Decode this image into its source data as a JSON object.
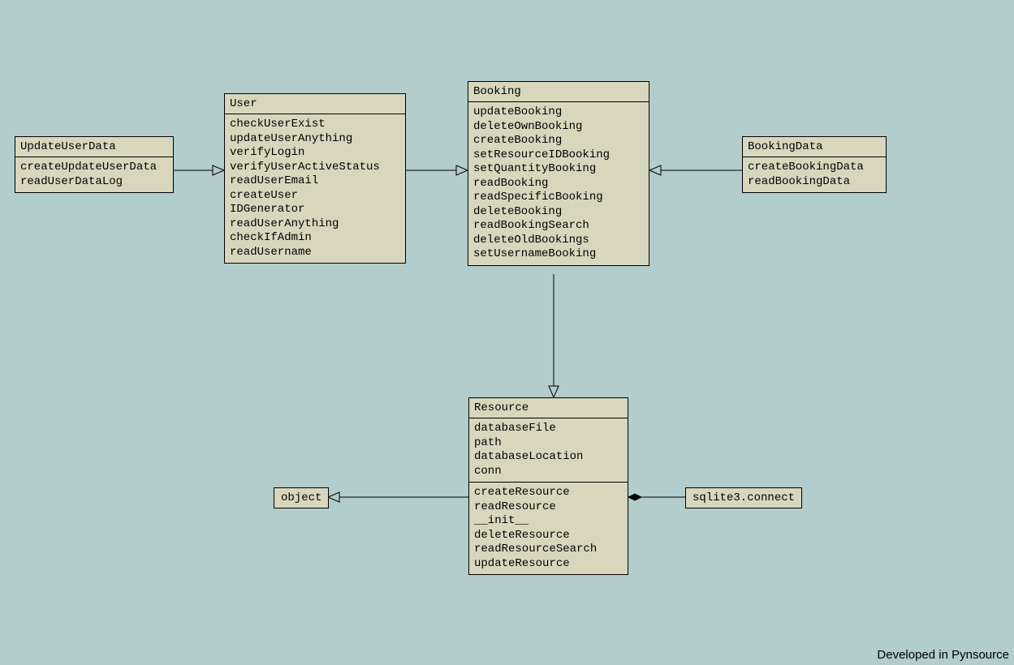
{
  "credit": "Developed in Pynsource",
  "classes": {
    "updateUserData": {
      "name": "UpdateUserData",
      "methods": [
        "createUpdateUserData",
        "readUserDataLog"
      ]
    },
    "user": {
      "name": "User",
      "methods": [
        "checkUserExist",
        "updateUserAnything",
        "verifyLogin",
        "verifyUserActiveStatus",
        "readUserEmail",
        "createUser",
        "IDGenerator",
        "readUserAnything",
        "checkIfAdmin",
        "readUsername"
      ]
    },
    "booking": {
      "name": "Booking",
      "methods": [
        "updateBooking",
        "deleteOwnBooking",
        "createBooking",
        "setResourceIDBooking",
        "setQuantityBooking",
        "readBooking",
        "readSpecificBooking",
        "deleteBooking",
        "readBookingSearch",
        "deleteOldBookings",
        "setUsernameBooking"
      ]
    },
    "bookingData": {
      "name": "BookingData",
      "methods": [
        "createBookingData",
        "readBookingData"
      ]
    },
    "resource": {
      "name": "Resource",
      "attributes": [
        "databaseFile",
        "path",
        "databaseLocation",
        "conn"
      ],
      "methods": [
        "createResource",
        "readResource",
        "__init__",
        "deleteResource",
        "readResourceSearch",
        "updateResource"
      ]
    },
    "object": {
      "name": "object"
    },
    "sqlite3connect": {
      "name": "sqlite3.connect"
    }
  },
  "relations": [
    {
      "from": "UpdateUserData",
      "to": "User",
      "type": "generalization"
    },
    {
      "from": "User",
      "to": "Booking",
      "type": "generalization"
    },
    {
      "from": "BookingData",
      "to": "Booking",
      "type": "generalization"
    },
    {
      "from": "Booking",
      "to": "Resource",
      "type": "generalization"
    },
    {
      "from": "Resource",
      "to": "object",
      "type": "generalization"
    },
    {
      "from": "sqlite3.connect",
      "to": "Resource",
      "type": "composition"
    }
  ]
}
